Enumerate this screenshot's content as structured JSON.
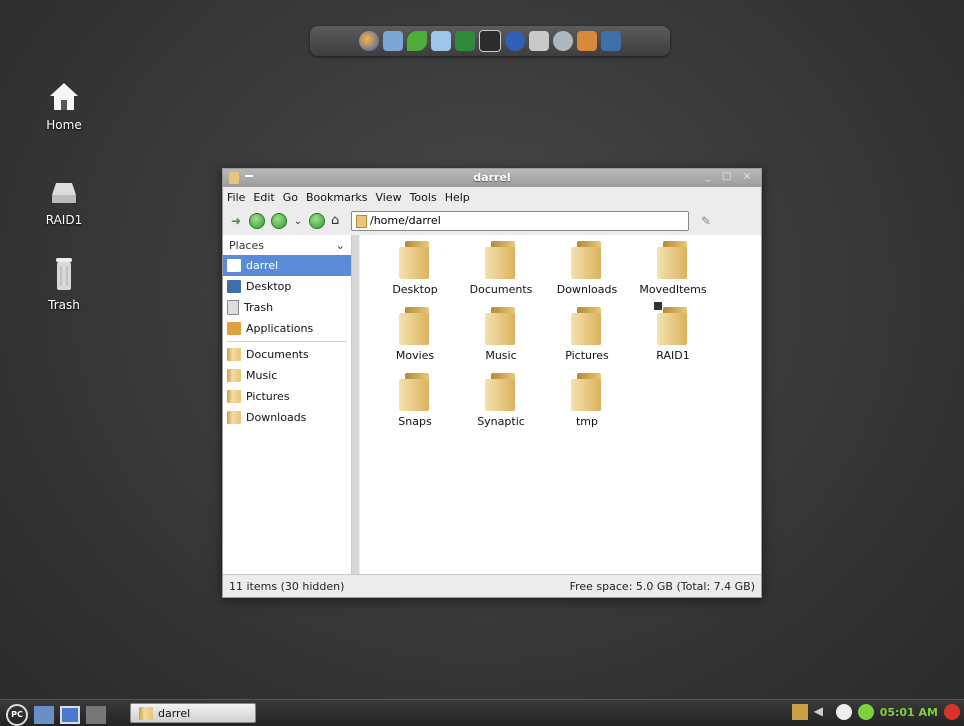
{
  "desktop": {
    "icons": [
      {
        "label": "Home",
        "icon": "home-icon"
      },
      {
        "label": "RAID1",
        "icon": "drive-icon"
      },
      {
        "label": "Trash",
        "icon": "trash-icon"
      }
    ]
  },
  "dock": {
    "icons": [
      "firefox-icon",
      "monitor-icon",
      "leaf-icon",
      "system-monitor-icon",
      "calculator-icon",
      "terminal-icon",
      "network-icon",
      "display-icon",
      "disk-tool-icon",
      "package-icon",
      "remote-desktop-icon"
    ]
  },
  "window": {
    "title": "darrel",
    "controls": "_ □ ×",
    "menu": [
      "File",
      "Edit",
      "Go",
      "Bookmarks",
      "View",
      "Tools",
      "Help"
    ],
    "location": "/home/darrel",
    "sidebar_header": "Places",
    "places": [
      {
        "label": "darrel",
        "icon": "home-icon",
        "selected": true
      },
      {
        "label": "Desktop",
        "icon": "desktop-icon"
      },
      {
        "label": "Trash",
        "icon": "trash-icon"
      },
      {
        "label": "Applications",
        "icon": "applications-icon"
      }
    ],
    "bookmarks": [
      {
        "label": "Documents"
      },
      {
        "label": "Music"
      },
      {
        "label": "Pictures"
      },
      {
        "label": "Downloads"
      }
    ],
    "files": [
      {
        "name": "Desktop"
      },
      {
        "name": "Documents"
      },
      {
        "name": "Downloads"
      },
      {
        "name": "MovedItems"
      },
      {
        "name": "Movies"
      },
      {
        "name": "Music"
      },
      {
        "name": "Pictures"
      },
      {
        "name": "RAID1",
        "emblem": true
      },
      {
        "name": "Snaps"
      },
      {
        "name": "Synaptic"
      },
      {
        "name": "tmp"
      }
    ],
    "status_left": "11 items (30 hidden)",
    "status_right": "Free space: 5.0 GB (Total: 7.4 GB)"
  },
  "taskbar": {
    "start_label": "PC",
    "task_label": "darrel",
    "clock": "05:01 AM"
  },
  "colors": {
    "selection": "#5b8bd6",
    "clock": "#7fd13b",
    "folder": "#e8c677"
  }
}
